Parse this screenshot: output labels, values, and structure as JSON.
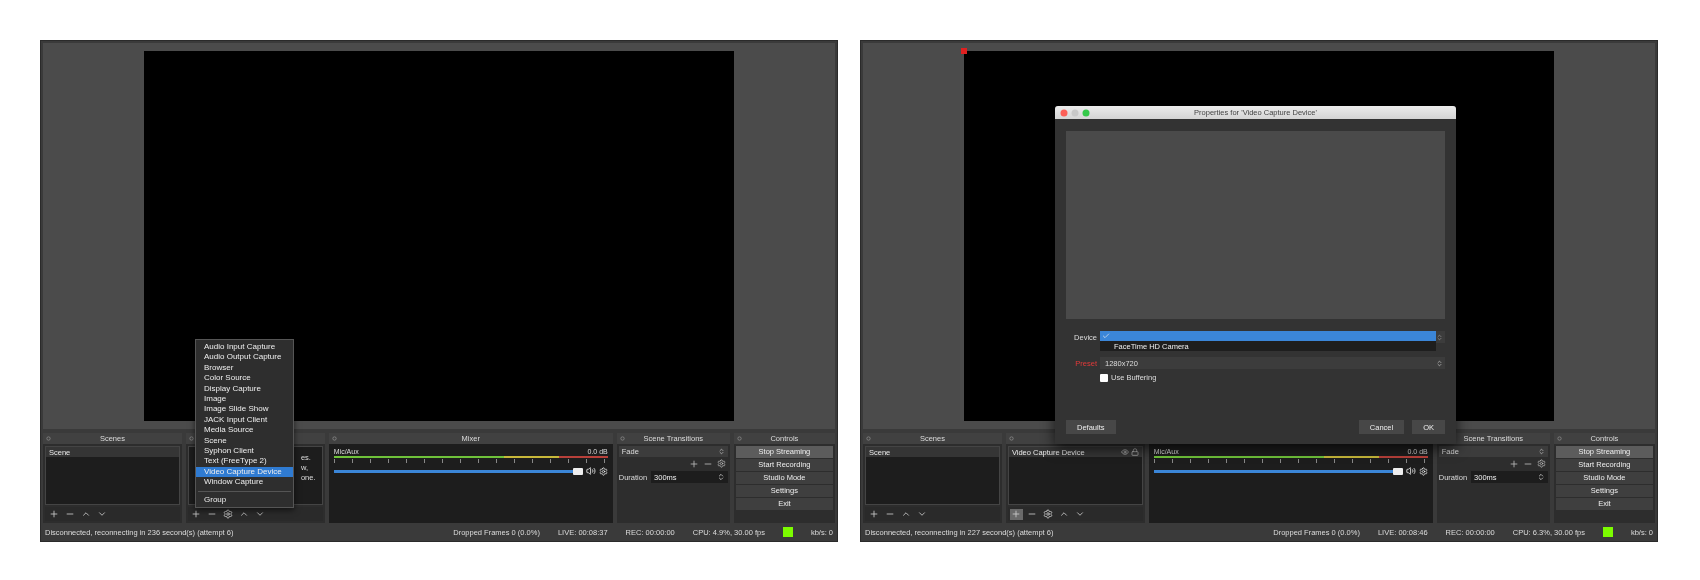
{
  "windows": [
    {
      "source_selected": false,
      "scenes": {
        "title": "Scenes",
        "items": [
          {
            "label": "Scene",
            "selected": true
          }
        ]
      },
      "sources": {
        "hint_fragments": [
          "es.",
          "w,",
          "one."
        ],
        "add_pressed": false
      },
      "mixer": {
        "title": "Mixer",
        "channels": [
          {
            "name": "Mic/Aux",
            "reading": "0.0 dB",
            "level": 1
          }
        ]
      },
      "transitions": {
        "title": "Scene Transitions",
        "transition": "Fade",
        "duration_label": "Duration",
        "duration": "300ms"
      },
      "controls": {
        "title": "Controls",
        "buttons": [
          {
            "label": "Stop Streaming",
            "active": true
          },
          {
            "label": "Start Recording",
            "active": false
          },
          {
            "label": "Studio Mode",
            "active": false
          },
          {
            "label": "Settings",
            "active": false
          },
          {
            "label": "Exit",
            "active": false
          }
        ]
      },
      "status": {
        "message": "Disconnected, reconnecting in 236 second(s) (attempt 6)",
        "dropped": "Dropped Frames 0 (0.0%)",
        "live": "LIVE: 00:08:37",
        "rec": "REC: 00:00:00",
        "cpu": "CPU: 4.9%, 30.00 fps",
        "kbps": "kb/s: 0"
      },
      "menu": {
        "items": [
          {
            "label": "Audio Input Capture",
            "selected": false
          },
          {
            "label": "Audio Output Capture",
            "selected": false
          },
          {
            "label": "Browser",
            "selected": false
          },
          {
            "label": "Color Source",
            "selected": false
          },
          {
            "label": "Display Capture",
            "selected": false
          },
          {
            "label": "Image",
            "selected": false
          },
          {
            "label": "Image Slide Show",
            "selected": false
          },
          {
            "label": "JACK Input Client",
            "selected": false
          },
          {
            "label": "Media Source",
            "selected": false
          },
          {
            "label": "Scene",
            "selected": false
          },
          {
            "label": "Syphon Client",
            "selected": false
          },
          {
            "label": "Text (FreeType 2)",
            "selected": false
          },
          {
            "label": "Video Capture Device",
            "selected": true
          },
          {
            "label": "Window Capture",
            "selected": false
          }
        ],
        "footer_items": [
          {
            "label": "Group",
            "selected": false
          }
        ]
      }
    },
    {
      "source_selected": true,
      "scenes": {
        "title": "Scenes",
        "items": [
          {
            "label": "Scene",
            "selected": true
          }
        ]
      },
      "sources": {
        "items": [
          {
            "label": "Video Capture Device",
            "selected": true
          }
        ],
        "add_pressed": true
      },
      "mixer": {
        "channels": [
          {
            "name": "Mic/Aux",
            "reading": "0.0 dB",
            "level": 1
          }
        ]
      },
      "transitions": {
        "title": "Scene Transitions",
        "transition": "Fade",
        "duration_label": "Duration",
        "duration": "300ms"
      },
      "controls": {
        "title": "Controls",
        "buttons": [
          {
            "label": "Stop Streaming",
            "active": true
          },
          {
            "label": "Start Recording",
            "active": false
          },
          {
            "label": "Studio Mode",
            "active": false
          },
          {
            "label": "Settings",
            "active": false
          },
          {
            "label": "Exit",
            "active": false
          }
        ]
      },
      "status": {
        "message": "Disconnected, reconnecting in 227 second(s) (attempt 6)",
        "dropped": "Dropped Frames 0 (0.0%)",
        "live": "LIVE: 00:08:46",
        "rec": "REC: 00:00:00",
        "cpu": "CPU: 6.3%, 30.00 fps",
        "kbps": "kb/s: 0"
      },
      "dialog": {
        "title": "Properties for 'Video Capture Device'",
        "device_label": "Device",
        "device_options": [
          {
            "checked": true,
            "selected": true
          },
          {
            "label": "FaceTime HD Camera",
            "checked": false,
            "selected": false
          }
        ],
        "preset_label": "Preset",
        "preset_value": "1280x720",
        "buffering": {
          "label": "Use Buffering",
          "checked": false
        },
        "buttons": [
          {
            "label": "Defaults",
            "kind": "left"
          },
          {
            "label": "Cancel",
            "kind": "right"
          },
          {
            "label": "OK",
            "kind": "right"
          }
        ]
      }
    }
  ]
}
